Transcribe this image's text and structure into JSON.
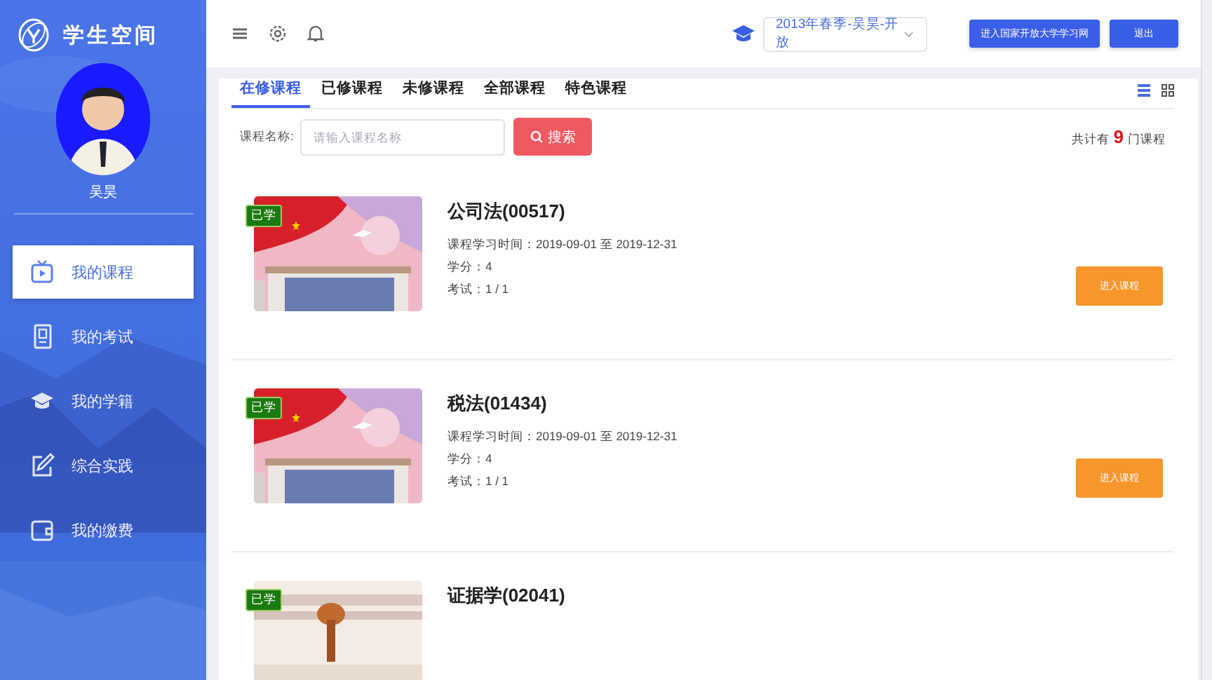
{
  "sidebar": {
    "title": "学生空间",
    "user_name": "吴昊",
    "items": [
      {
        "label": "我的课程",
        "selected": true
      },
      {
        "label": "我的考试",
        "selected": false
      },
      {
        "label": "我的学籍",
        "selected": false
      },
      {
        "label": "综合实践",
        "selected": false
      },
      {
        "label": "我的缴费",
        "selected": false
      }
    ]
  },
  "topbar": {
    "term_select": {
      "value": "2013年春季-吴昊-开放"
    },
    "buttons": [
      "进入国家开放大学学习网",
      "退出"
    ]
  },
  "panel": {
    "tabs": [
      {
        "label": "在修课程",
        "selected": true
      },
      {
        "label": "已修课程",
        "selected": false
      },
      {
        "label": "未修课程",
        "selected": false
      },
      {
        "label": "全部课程",
        "selected": false
      },
      {
        "label": "特色课程",
        "selected": false
      }
    ],
    "view_modes": [
      {
        "selected": true
      },
      {
        "selected": false
      }
    ],
    "search": {
      "label": "课程名称:",
      "placeholder": "请输入课程名称",
      "button": "搜索"
    },
    "total": {
      "prefix": "共计有",
      "count": "9",
      "suffix": "门课程"
    },
    "courses": [
      {
        "title": "公司法(00517)",
        "badge": "已学",
        "details": [
          "课程学习时间：2019-09-01 至 2019-12-31",
          "学分：4",
          "考试：1 / 1"
        ],
        "action": "进入课程"
      },
      {
        "title": "税法(01434)",
        "badge": "已学",
        "details": [
          "课程学习时间：2019-09-01 至 2019-12-31",
          "学分：4",
          "考试：1 / 1"
        ],
        "action": "进入课程"
      },
      {
        "title": "证据学(02041)",
        "badge": "已学"
      }
    ]
  }
}
